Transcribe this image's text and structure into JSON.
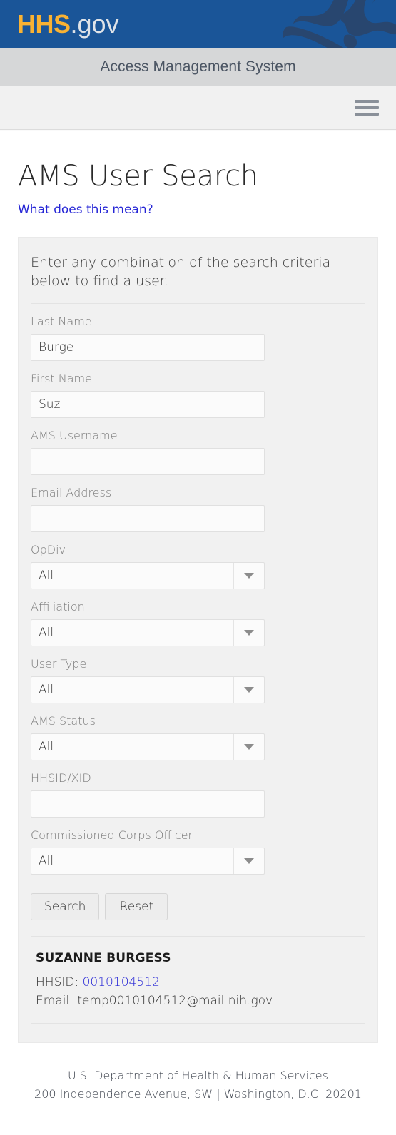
{
  "banner": {
    "logo_primary": "HHS",
    "logo_secondary": ".gov",
    "logo_icon": "hhs-bird-logo",
    "background_color": "#1a5598",
    "logo_color": "#f9b233"
  },
  "app_header": {
    "title": "Access Management System"
  },
  "navbar": {
    "menu_icon": "hamburger-menu-icon"
  },
  "main": {
    "page_title": "AMS User Search",
    "help_link": "What does this mean?",
    "instructions": "Enter any combination of the search criteria below to find a user."
  },
  "form": {
    "fields": [
      {
        "label": "Last Name",
        "type": "text",
        "value": "Burge",
        "placeholder": ""
      },
      {
        "label": "First Name",
        "type": "text",
        "value": "Suz",
        "placeholder": ""
      },
      {
        "label": "AMS Username",
        "type": "text",
        "value": "",
        "placeholder": ""
      },
      {
        "label": "Email Address",
        "type": "text",
        "value": "",
        "placeholder": ""
      },
      {
        "label": "OpDiv",
        "type": "select",
        "value": "All"
      },
      {
        "label": "Affiliation",
        "type": "select",
        "value": "All"
      },
      {
        "label": "User Type",
        "type": "select",
        "value": "All"
      },
      {
        "label": "AMS Status",
        "type": "select",
        "value": "All"
      },
      {
        "label": "HHSID/XID",
        "type": "text",
        "value": "",
        "placeholder": ""
      },
      {
        "label": "Commissioned Corps Officer",
        "type": "select",
        "value": "All"
      }
    ],
    "search_button": "Search",
    "reset_button": "Reset"
  },
  "results": [
    {
      "name": "SUZANNE BURGESS",
      "hhsid_label": "HHSID:",
      "hhsid_value": "0010104512",
      "email_label": "Email:",
      "email_value": "temp0010104512@mail.nih.gov"
    }
  ],
  "footer": {
    "line1": "U.S. Department of Health & Human Services",
    "line2": "200 Independence Avenue, SW | Washington, D.C. 20201"
  }
}
